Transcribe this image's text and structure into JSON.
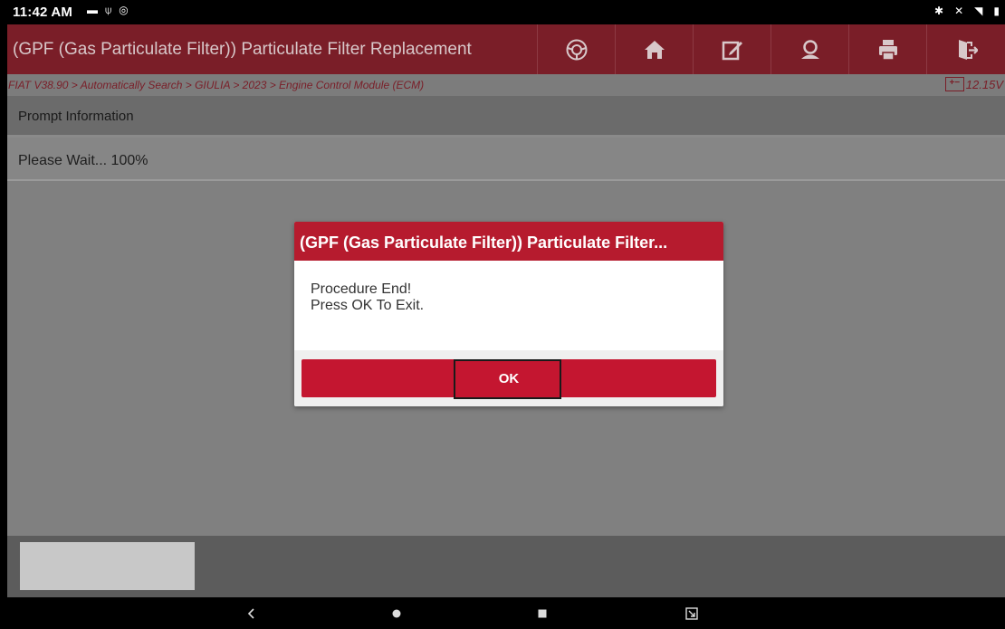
{
  "status_bar": {
    "time": "11:42 AM",
    "left_icons": [
      "gallery-icon",
      "usb-icon",
      "chat-icon"
    ],
    "right_icons": [
      "bluetooth-icon",
      "mute-icon",
      "wifi-icon",
      "battery-icon"
    ]
  },
  "header": {
    "title": "(GPF (Gas Particulate Filter)) Particulate Filter Replacement",
    "toolbar": [
      "steering-wheel-icon",
      "home-icon",
      "edit-icon",
      "support-icon",
      "print-icon",
      "exit-icon"
    ]
  },
  "breadcrumb": {
    "path": "FIAT V38.90 > Automatically Search > GIULIA > 2023 > Engine Control Module (ECM)",
    "voltage": "12.15V"
  },
  "prompt": {
    "header": "Prompt Information",
    "status": "Please Wait... 100%"
  },
  "dialog": {
    "title": "(GPF (Gas Particulate Filter)) Particulate Filter...",
    "line1": "Procedure End!",
    "line2": "Press OK To Exit.",
    "ok_label": "OK"
  },
  "colors": {
    "header_bg": "#7a1e28",
    "dialog_title_bg": "#b61b2e",
    "ok_button_bg": "#c41630"
  }
}
